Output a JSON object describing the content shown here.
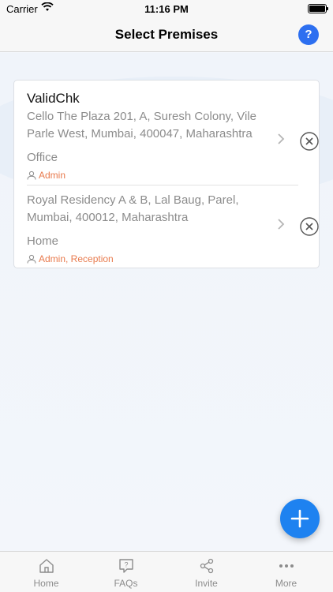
{
  "status_bar": {
    "carrier": "Carrier",
    "time": "11:16 PM"
  },
  "nav": {
    "title": "Select Premises",
    "help_label": "?"
  },
  "premises": [
    {
      "name": "ValidChk",
      "address": "Cello The Plaza 201, A, Suresh Colony, Vile Parle West, Mumbai, 400047, Maharashtra",
      "type": "Office",
      "roles": "Admin"
    },
    {
      "name": "",
      "address": "Royal Residency A & B, Lal Baug, Parel, Mumbai, 400012, Maharashtra",
      "type": "Home",
      "roles": "Admin, Reception"
    }
  ],
  "tabs": [
    {
      "label": "Home",
      "icon": "home-icon"
    },
    {
      "label": "FAQs",
      "icon": "faq-icon"
    },
    {
      "label": "Invite",
      "icon": "share-icon"
    },
    {
      "label": "More",
      "icon": "more-icon"
    }
  ],
  "colors": {
    "accent": "#2d6ff0",
    "fab": "#1e82f0",
    "role": "#e87a4d"
  }
}
